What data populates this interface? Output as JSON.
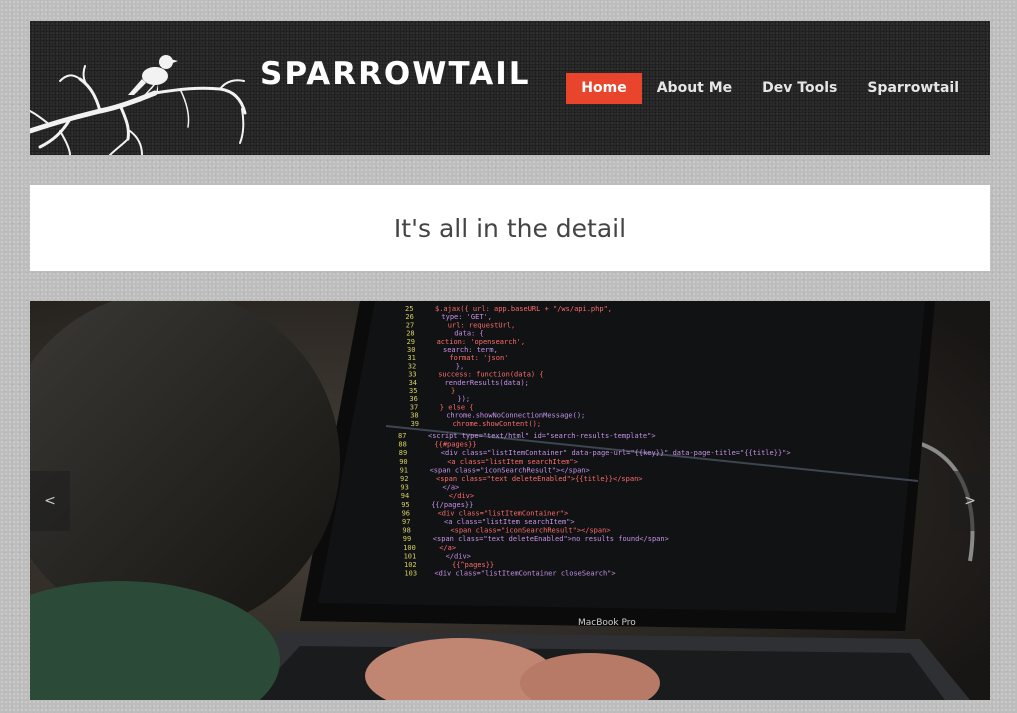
{
  "header": {
    "site_title": "SPARROWTAIL",
    "nav": [
      {
        "label": "Home",
        "active": true
      },
      {
        "label": "About Me",
        "active": false
      },
      {
        "label": "Dev Tools",
        "active": false
      },
      {
        "label": "Sparrowtail",
        "active": false
      }
    ]
  },
  "banner": {
    "tagline": "It's all in the detail"
  },
  "slider": {
    "prev_label": "<",
    "next_label": ">",
    "laptop_brand": "MacBook Pro",
    "code_lines_top": [
      "$.ajax({ url: app.baseURL + \"/ws/api.php\",",
      "type: 'GET',",
      "url: requestUrl,",
      "data: {",
      "action: 'opensearch',",
      "search: term,",
      "format: 'json'",
      "},",
      "success: function(data) {",
      "renderResults(data);",
      "}",
      "});",
      "} else {",
      "chrome.showNoConnectionMessage();",
      "chrome.showContent();"
    ],
    "code_lines_bottom": [
      "<script type=\"text/html\" id=\"search-results-template\">",
      "{{#pages}}",
      "<div class=\"listItemContainer\" data-page-url=\"{{key}}\" data-page-title=\"{{title}}\">",
      "<a class=\"listItem searchItem\">",
      "<span class=\"iconSearchResult\"></span>",
      "<span class=\"text deleteEnabled\">{{title}}</span>",
      "</a>",
      "</div>",
      "{{/pages}}",
      "<div class=\"listItemContainer\">",
      "<a class=\"listItem searchItem\">",
      "<span class=\"iconSearchResult\"></span>",
      "<span class=\"text deleteEnabled\">no results found</span>",
      "</a>",
      "</div>",
      "{{^pages}}",
      "<div class=\"listItemContainer closeSearch\">"
    ]
  }
}
